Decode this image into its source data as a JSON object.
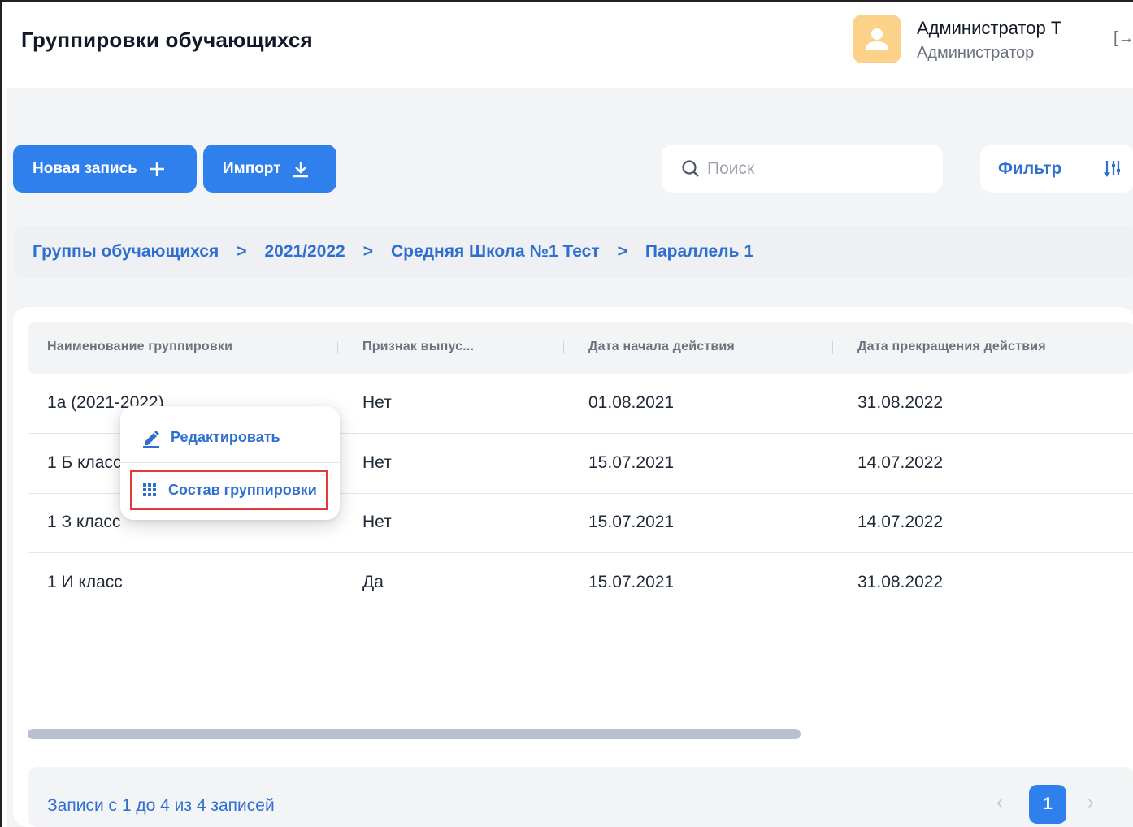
{
  "header": {
    "title": "Группировки обучающихся",
    "user_name": "Администратор Т",
    "user_role": "Администратор",
    "logout_icon": "[→"
  },
  "toolbar": {
    "new_label": "Новая запись",
    "import_label": "Импорт",
    "search_placeholder": "Поиск",
    "filter_label": "Фильтр"
  },
  "breadcrumb": {
    "items": [
      "Группы обучающихся",
      "2021/2022",
      "Средняя Школа №1 Тест",
      "Параллель 1"
    ],
    "separator": ">"
  },
  "table": {
    "columns": [
      "Наименование группировки",
      "Признак выпус...",
      "Дата начала действия",
      "Дата прекращения действия"
    ],
    "rows": [
      {
        "name": "1а (2021-2022)",
        "flag": "Нет",
        "start": "01.08.2021",
        "end": "31.08.2022"
      },
      {
        "name": "1 Б класс",
        "flag": "Нет",
        "start": "15.07.2021",
        "end": "14.07.2022"
      },
      {
        "name": "1 З класс",
        "flag": "Нет",
        "start": "15.07.2021",
        "end": "14.07.2022"
      },
      {
        "name": "1 И класс",
        "flag": "Да",
        "start": "15.07.2021",
        "end": "31.08.2022"
      }
    ]
  },
  "context_menu": {
    "edit_label": "Редактировать",
    "composition_label": "Состав группировки"
  },
  "footer": {
    "records_text": "Записи с 1 до 4 из 4 записей",
    "current_page": "1",
    "prev": "‹",
    "next": "›"
  },
  "colors": {
    "primary": "#2f80ed",
    "link": "#2f6fd0",
    "highlight": "#e23a3a",
    "avatar": "#fcd28a"
  }
}
